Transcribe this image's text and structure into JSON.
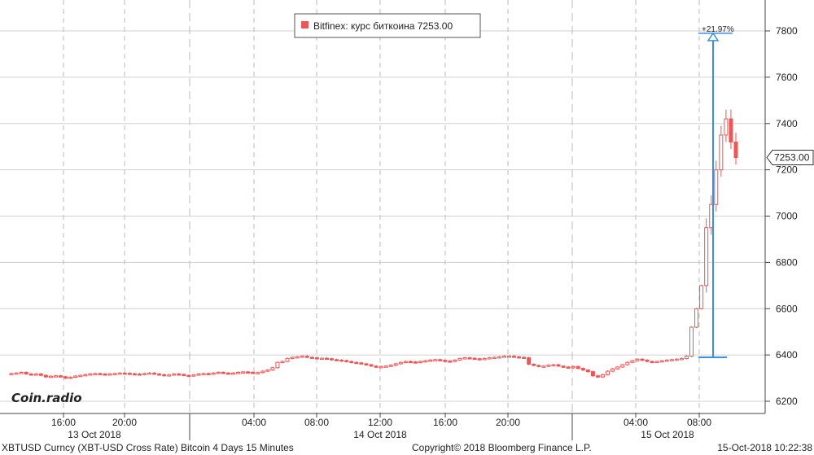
{
  "colors": {
    "candle": "#ee5555",
    "measure": "#3a8ee6",
    "grid": "#d0d0d0",
    "dashed": "#bbbbbb",
    "axis": "#444444"
  },
  "legend": {
    "label": "Bitfinex: курс биткоина 7253.00"
  },
  "last_price_label": "7253.00",
  "measure_label": "+21.97%",
  "watermark": "Coin.radio",
  "footer": {
    "left": "XBTUSD Curncy (XBT-USD Cross Rate) Bitcoin 4 Days 15 Minutes",
    "center": "Copyright© 2018 Bloomberg Finance L.P.",
    "right": "15-Oct-2018 10:22:38"
  },
  "chart_data": {
    "type": "candlestick",
    "y_axis_position": "right",
    "ylim": [
      6150,
      7950
    ],
    "y_ticks": [
      6200,
      6400,
      6600,
      6800,
      7000,
      7200,
      7400,
      7600,
      7800
    ],
    "x_time_ticks": [
      "16:00",
      "20:00",
      "04:00",
      "08:00",
      "12:00",
      "16:00",
      "20:00",
      "04:00",
      "08:00"
    ],
    "x_date_labels": [
      "13 Oct 2018",
      "14 Oct 2018",
      "15 Oct 2018"
    ],
    "last_value": 7253.0,
    "measure": {
      "from": 6390,
      "to": 7790,
      "change": "+21.97%"
    },
    "series_name": "Bitfinex: курс биткоина",
    "values": [
      6320,
      6322,
      6325,
      6318,
      6315,
      6318,
      6312,
      6305,
      6308,
      6310,
      6306,
      6300,
      6304,
      6309,
      6312,
      6315,
      6318,
      6320,
      6318,
      6316,
      6318,
      6320,
      6322,
      6321,
      6319,
      6318,
      6316,
      6320,
      6322,
      6318,
      6315,
      6312,
      6314,
      6318,
      6316,
      6312,
      6310,
      6314,
      6318,
      6320,
      6318,
      6322,
      6325,
      6322,
      6320,
      6322,
      6325,
      6327,
      6325,
      6322,
      6324,
      6330,
      6335,
      6345,
      6368,
      6372,
      6385,
      6390,
      6392,
      6395,
      6390,
      6388,
      6385,
      6386,
      6384,
      6380,
      6378,
      6376,
      6372,
      6368,
      6366,
      6362,
      6358,
      6352,
      6348,
      6350,
      6352,
      6356,
      6362,
      6368,
      6372,
      6370,
      6368,
      6372,
      6375,
      6378,
      6380,
      6377,
      6374,
      6372,
      6378,
      6385,
      6388,
      6386,
      6384,
      6382,
      6385,
      6388,
      6390,
      6392,
      6395,
      6395,
      6392,
      6390,
      6388,
      6360,
      6355,
      6350,
      6352,
      6356,
      6358,
      6352,
      6348,
      6345,
      6350,
      6342,
      6335,
      6328,
      6310,
      6305,
      6315,
      6330,
      6340,
      6348,
      6358,
      6368,
      6375,
      6382,
      6378,
      6372,
      6370,
      6372,
      6375,
      6378,
      6380,
      6382,
      6385,
      6395,
      6520,
      6600,
      6700,
      6950,
      7050,
      7200,
      7350,
      7420,
      7320,
      7253
    ]
  }
}
